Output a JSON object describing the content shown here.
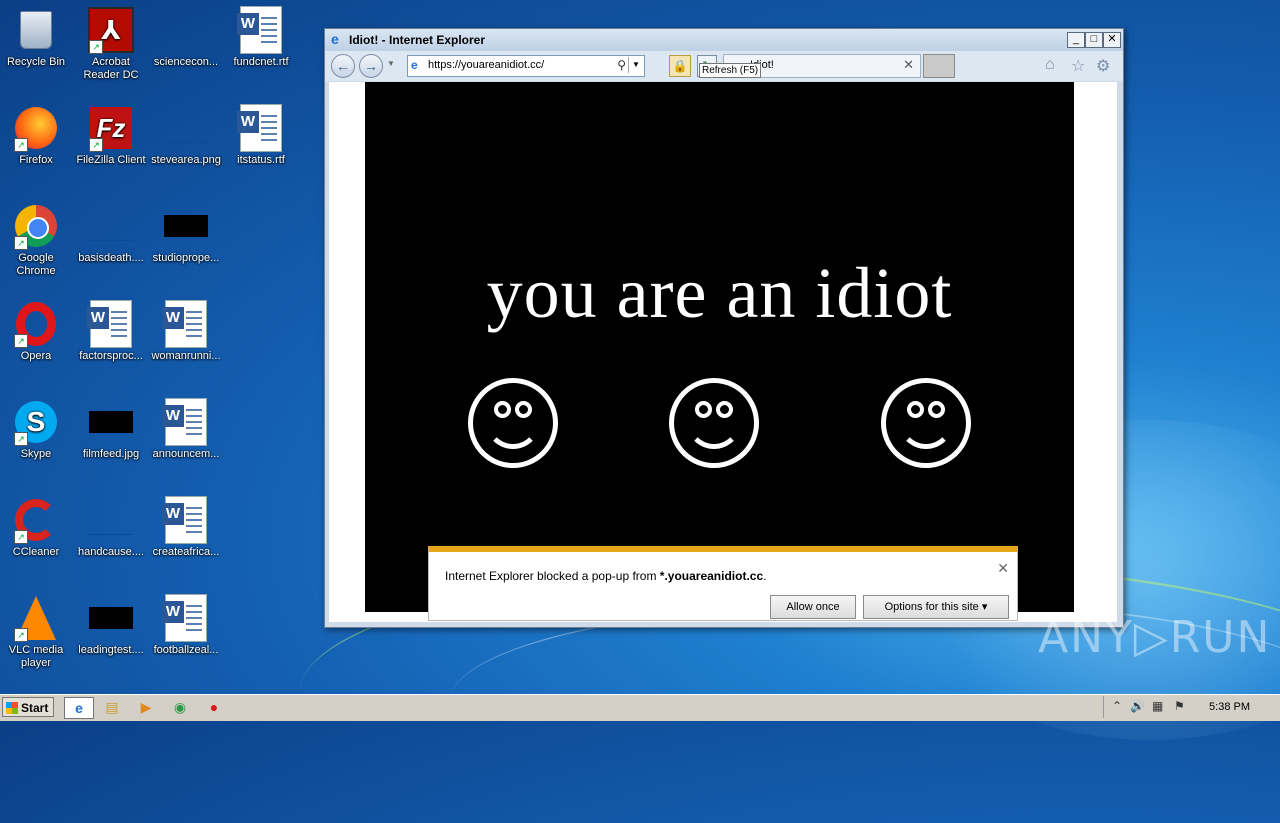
{
  "desktop": {
    "icons": [
      {
        "label": "Recycle Bin"
      },
      {
        "label": "Acrobat Reader DC"
      },
      {
        "label": "sciencecon..."
      },
      {
        "label": "fundcnet.rtf"
      },
      {
        "label": "Firefox"
      },
      {
        "label": "FileZilla Client"
      },
      {
        "label": "stevearea.png"
      },
      {
        "label": "itstatus.rtf"
      },
      {
        "label": "Google Chrome"
      },
      {
        "label": "basisdeath...."
      },
      {
        "label": "studioprope..."
      },
      {
        "label": "Opera"
      },
      {
        "label": "factorsproc..."
      },
      {
        "label": "womanrunni..."
      },
      {
        "label": "Skype"
      },
      {
        "label": "filmfeed.jpg"
      },
      {
        "label": "announcem..."
      },
      {
        "label": "CCleaner"
      },
      {
        "label": "handcause...."
      },
      {
        "label": "createafrica..."
      },
      {
        "label": "VLC media player"
      },
      {
        "label": "leadingtest...."
      },
      {
        "label": "footballzeal..."
      }
    ]
  },
  "browser": {
    "window_title": "Idiot! - Internet Explorer",
    "address": "https://youareanidiot.cc/",
    "tooltip": "Refresh (F5)",
    "tab_label": "Idiot!",
    "page": {
      "headline": "you are an idiot"
    },
    "notification": {
      "message_prefix": "Internet Explorer blocked a pop-up from ",
      "domain": "*.youareanidiot.cc",
      "message_suffix": ".",
      "allow_once": "Allow once",
      "options": "Options for this site"
    }
  },
  "watermark": "ANY▷RUN",
  "taskbar": {
    "start_label": "Start",
    "clock": "5:38 PM"
  }
}
